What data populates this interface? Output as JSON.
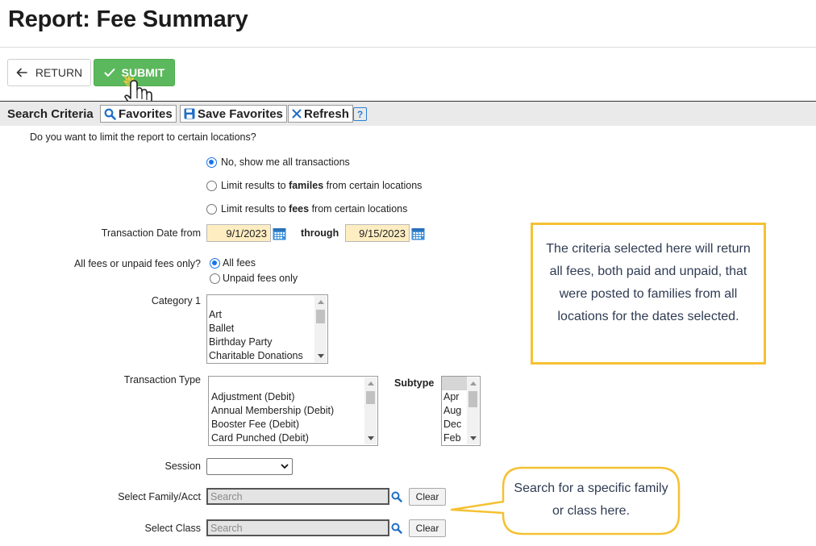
{
  "header": {
    "title": "Report: Fee Summary"
  },
  "toolbar": {
    "return_label": "RETURN",
    "submit_label": "SUBMIT"
  },
  "criteria_bar": {
    "title": "Search Criteria",
    "favorites_label": "Favorites",
    "save_favorites_label": "Save Favorites",
    "refresh_label": "Refresh",
    "help_label": "?"
  },
  "locations": {
    "question": "Do you want to limit the report to certain locations?",
    "option_all": "No, show me all transactions",
    "option_families_pre": "Limit results to ",
    "option_families_bold": "familes",
    "option_families_post": " from certain locations",
    "option_fees_pre": "Limit results to ",
    "option_fees_bold": "fees",
    "option_fees_post": " from certain locations"
  },
  "date": {
    "label": "Transaction Date from",
    "from_value": "9/1/2023",
    "through_label": "through",
    "to_value": "9/15/2023"
  },
  "fee_type": {
    "label": "All fees or unpaid fees only?",
    "option_all": "All fees",
    "option_unpaid": "Unpaid fees only"
  },
  "category1": {
    "label": "Category 1",
    "options": [
      "Art",
      "Ballet",
      "Birthday Party",
      "Charitable Donations"
    ]
  },
  "transaction_type": {
    "label": "Transaction Type",
    "options": [
      "Adjustment (Debit)",
      "Annual Membership (Debit)",
      "Booster Fee (Debit)",
      "Card Punched (Debit)"
    ]
  },
  "subtype": {
    "label": "Subtype",
    "options": [
      "Apr",
      "Aug",
      "Dec",
      "Feb"
    ]
  },
  "session": {
    "label": "Session",
    "value": ""
  },
  "family": {
    "label": "Select Family/Acct",
    "placeholder": "Search",
    "clear_label": "Clear"
  },
  "class_select": {
    "label": "Select Class",
    "placeholder": "Search",
    "clear_label": "Clear"
  },
  "callouts": {
    "criteria_note": "The criteria selected here will return all fees, both paid and unpaid, that were posted to families from all locations for the dates selected.",
    "search_note": "Search for a specific family or class here."
  },
  "colors": {
    "submit_green": "#5cb85c",
    "date_field": "#ffedc2",
    "callout_yellow": "#f5c132",
    "link_blue": "#1a73e8"
  }
}
